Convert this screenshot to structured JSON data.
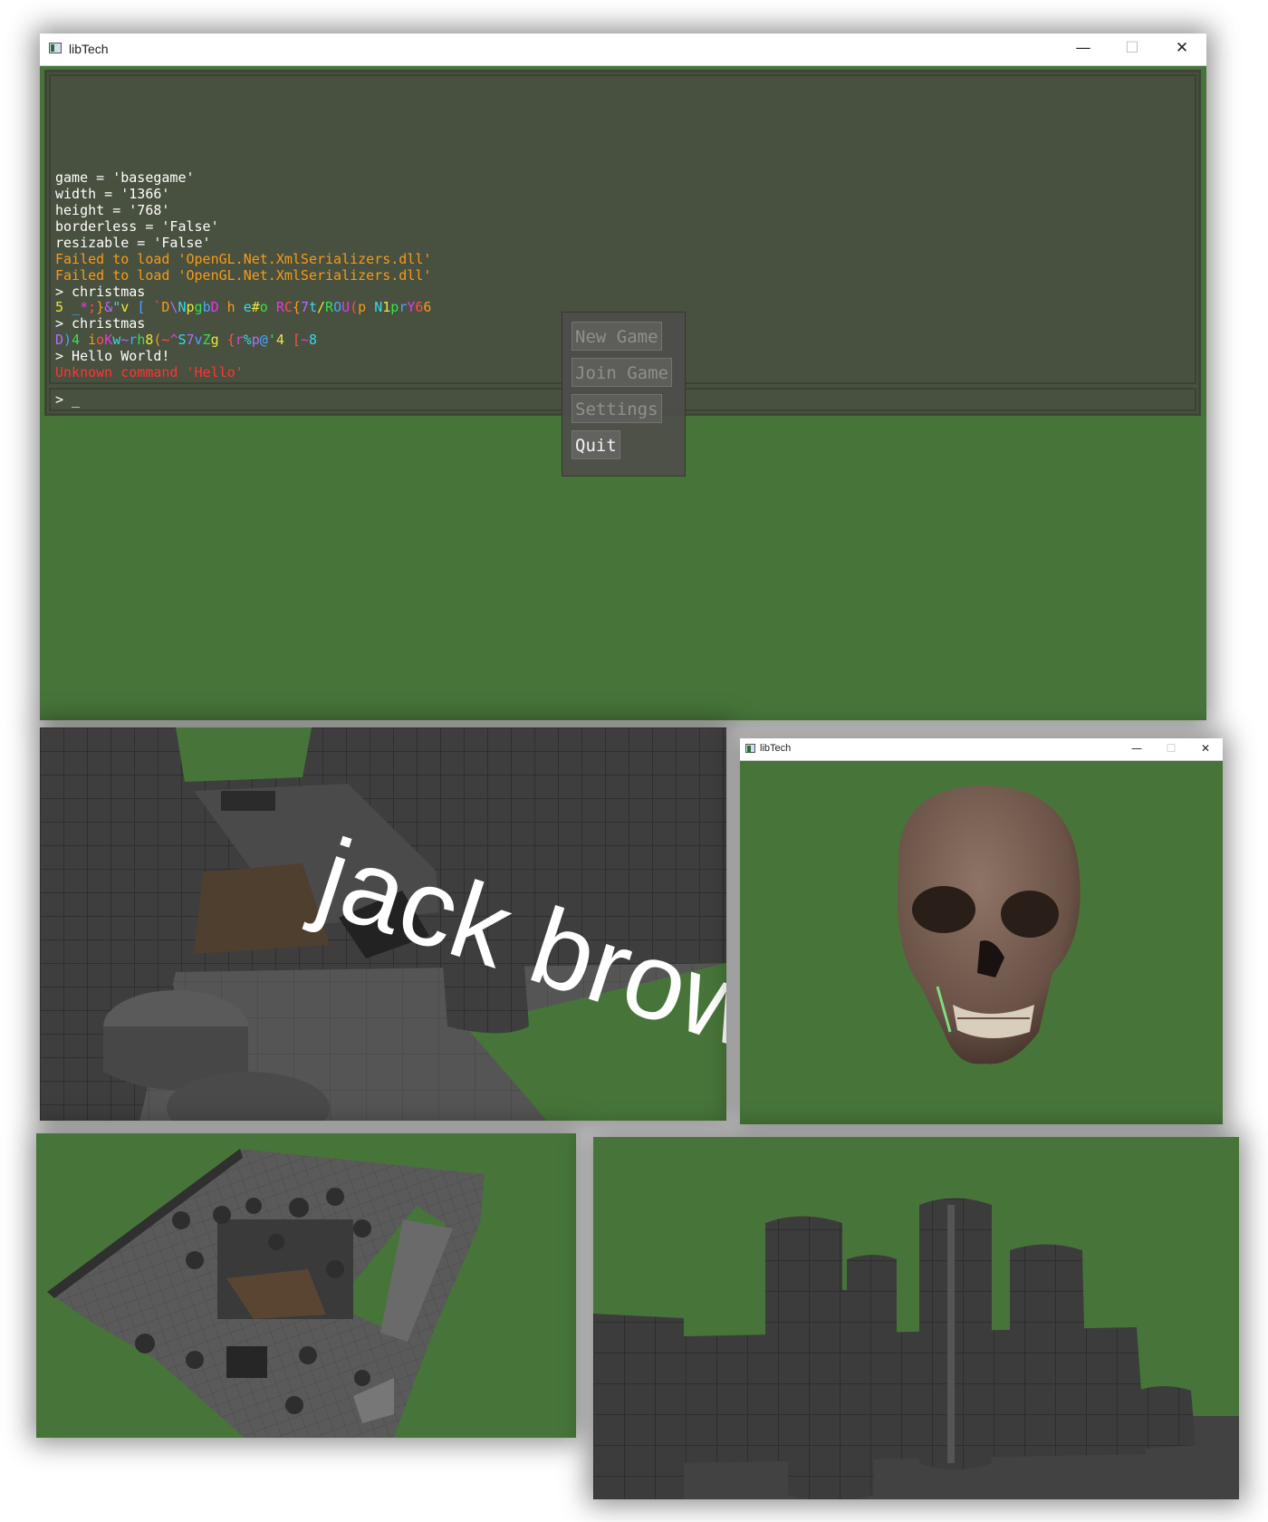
{
  "main_window": {
    "title": "libTech",
    "controls": {
      "minimize": "—",
      "maximize": "☐",
      "close": "✕"
    },
    "console": {
      "lines": [
        {
          "text": "game = 'basegame'",
          "kind": "normal"
        },
        {
          "text": "width = '1366'",
          "kind": "normal"
        },
        {
          "text": "height = '768'",
          "kind": "normal"
        },
        {
          "text": "borderless = 'False'",
          "kind": "normal"
        },
        {
          "text": "resizable = 'False'",
          "kind": "normal"
        },
        {
          "text": "Failed to load 'OpenGL.Net.XmlSerializers.dll'",
          "kind": "warn"
        },
        {
          "text": "Failed to load 'OpenGL.Net.XmlSerializers.dll'",
          "kind": "warn"
        },
        {
          "text": "> christmas",
          "kind": "normal"
        },
        {
          "text": "5 _*;}&\"v [ `D\\NpgbD h e#o RC{7t/ROU(p N1prY66",
          "kind": "rainbow",
          "colors": [
            "#e9e93a",
            "#36e24c",
            "#4aa3ff",
            "#e43ae1",
            "#ff4d4d",
            "#f59b1a",
            "#b06cff",
            "#3ad7e9"
          ]
        },
        {
          "text": "> christmas",
          "kind": "normal"
        },
        {
          "text": "D)4 ioKw~rh8(~^S7vZg {r%p@'4 [~8",
          "kind": "rainbow",
          "colors": [
            "#b06cff",
            "#4aa3ff",
            "#36e24c",
            "#e9e93a",
            "#f59b1a",
            "#ff4d4d",
            "#e43ae1",
            "#3ad7e9"
          ]
        },
        {
          "text": "> Hello World!",
          "kind": "normal"
        },
        {
          "text": "Unknown command 'Hello'",
          "kind": "err"
        }
      ],
      "input_prompt": "> _"
    },
    "menu": [
      {
        "label": "New Game",
        "state": "dim"
      },
      {
        "label": "Join Game",
        "state": "dim"
      },
      {
        "label": "Settings",
        "state": "dim"
      },
      {
        "label": "Quit",
        "state": "lit"
      }
    ]
  },
  "scene_1": {
    "floating_text": "jack brow"
  },
  "scene_2": {
    "title": "libTech",
    "controls": {
      "minimize": "—",
      "maximize": "☐",
      "close": "✕"
    }
  },
  "colors": {
    "clear_green": "#477539",
    "console_bg": "#48503f",
    "warning": "#f59b1a",
    "error": "#ff3434",
    "wall_dark": "#3c3c3c"
  }
}
